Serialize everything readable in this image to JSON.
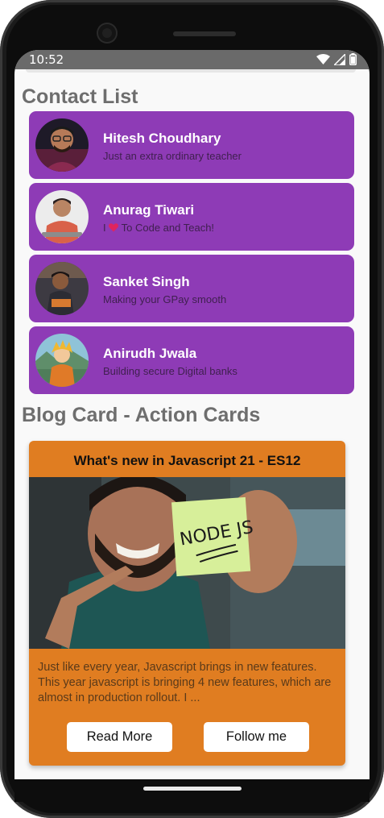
{
  "status_bar": {
    "time": "10:52",
    "icons": [
      "wifi-icon",
      "signal-icon",
      "battery-icon"
    ]
  },
  "contact_section": {
    "title": "Contact List",
    "contacts": [
      {
        "name": "Hitesh Choudhary",
        "subtitle": "Just an extra ordinary teacher",
        "avatar": "hitesh-avatar"
      },
      {
        "name": "Anurag Tiwari",
        "subtitle_prefix": "I",
        "subtitle_icon": "heart-icon",
        "subtitle_suffix": "To Code and Teach!",
        "avatar": "anurag-avatar"
      },
      {
        "name": "Sanket Singh",
        "subtitle": "Making your GPay smooth",
        "avatar": "sanket-avatar"
      },
      {
        "name": "Anirudh Jwala",
        "subtitle": "Building secure Digital banks",
        "avatar": "anirudh-avatar"
      }
    ]
  },
  "blog_section": {
    "title": "Blog Card - Action Cards",
    "card": {
      "title": "What's new in Javascript 21 - ES12",
      "image": "node-js-sticky-note-photo",
      "sticky_note_text": "NODE JS",
      "body": "Just like every year, Javascript brings in new features. This year javascript is bringing 4 new features, which are almost in production rollout. I ...",
      "buttons": {
        "read_more": "Read More",
        "follow": "Follow me"
      }
    }
  },
  "colors": {
    "contact_card": "#8e3bb6",
    "blog_card": "#e07d21",
    "section_title": "#6e6e6e",
    "screen_bg": "#f9f9f9",
    "heart": "#e0245e"
  }
}
